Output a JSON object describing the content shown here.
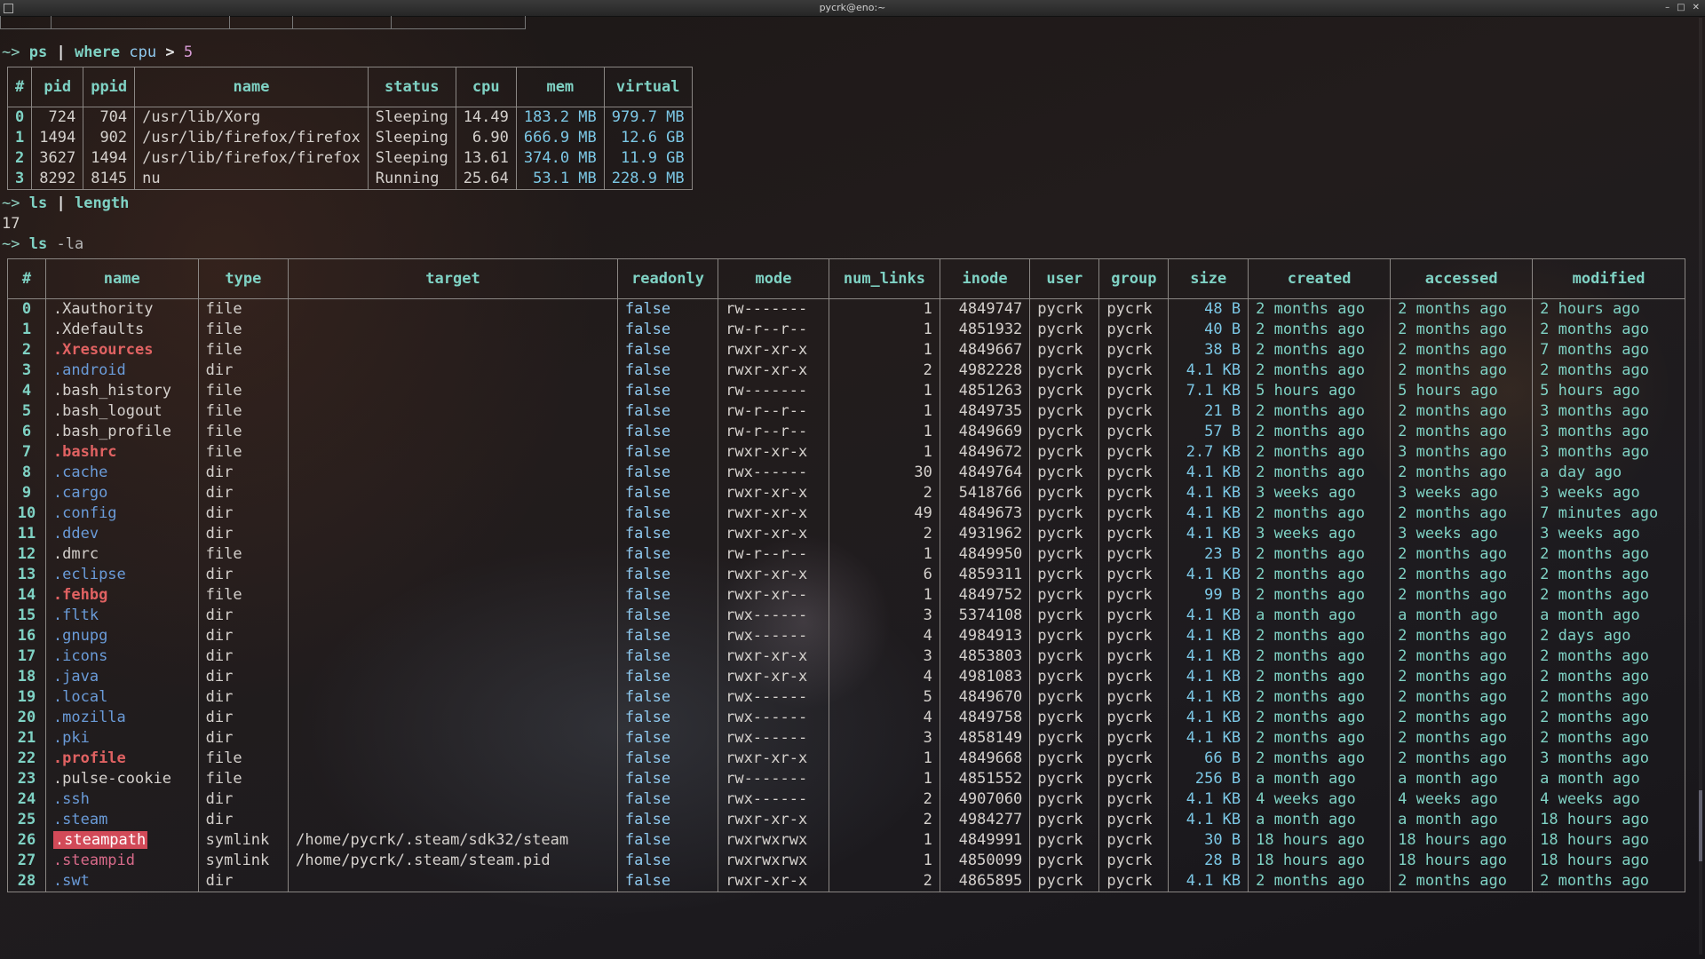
{
  "window": {
    "title": "pycrk@eno:~"
  },
  "prompt": "~>",
  "cmd1": {
    "a": "ps",
    "pipe": "|",
    "kw": "where",
    "col": "cpu",
    "op": ">",
    "val": "5"
  },
  "ps_table": {
    "headers": [
      "#",
      "pid",
      "ppid",
      "name",
      "status",
      "cpu",
      "mem",
      "virtual"
    ],
    "rows": [
      [
        "0",
        "724",
        "704",
        "/usr/lib/Xorg",
        "Sleeping",
        "14.49",
        "183.2 MB",
        "979.7 MB"
      ],
      [
        "1",
        "1494",
        "902",
        "/usr/lib/firefox/firefox",
        "Sleeping",
        "6.90",
        "666.9 MB",
        "12.6 GB"
      ],
      [
        "2",
        "3627",
        "1494",
        "/usr/lib/firefox/firefox",
        "Sleeping",
        "13.61",
        "374.0 MB",
        "11.9 GB"
      ],
      [
        "3",
        "8292",
        "8145",
        "nu",
        "Running",
        "25.64",
        "53.1 MB",
        "228.9 MB"
      ]
    ]
  },
  "cmd2": {
    "a": "ls",
    "pipe": "|",
    "kw": "length"
  },
  "out2": "17",
  "cmd3": {
    "a": "ls",
    "flag": "-la"
  },
  "ls_table": {
    "headers": [
      "#",
      "name",
      "type",
      "target",
      "readonly",
      "mode",
      "num_links",
      "inode",
      "user",
      "group",
      "size",
      "created",
      "accessed",
      "modified"
    ],
    "rows": [
      [
        "0",
        ".Xauthority",
        "file",
        "",
        "false",
        "rw-------",
        "1",
        "4849747",
        "pycrk",
        "pycrk",
        "48 B",
        "2 months ago",
        "2 months ago",
        "2 hours ago",
        "file"
      ],
      [
        "1",
        ".Xdefaults",
        "file",
        "",
        "false",
        "rw-r--r--",
        "1",
        "4851932",
        "pycrk",
        "pycrk",
        "40 B",
        "2 months ago",
        "2 months ago",
        "2 months ago",
        "file"
      ],
      [
        "2",
        ".Xresources",
        "file",
        "",
        "false",
        "rwxr-xr-x",
        "1",
        "4849667",
        "pycrk",
        "pycrk",
        "38 B",
        "2 months ago",
        "2 months ago",
        "7 months ago",
        "exec"
      ],
      [
        "3",
        ".android",
        "dir",
        "",
        "false",
        "rwxr-xr-x",
        "2",
        "4982228",
        "pycrk",
        "pycrk",
        "4.1 KB",
        "2 months ago",
        "2 months ago",
        "2 months ago",
        "dir"
      ],
      [
        "4",
        ".bash_history",
        "file",
        "",
        "false",
        "rw-------",
        "1",
        "4851263",
        "pycrk",
        "pycrk",
        "7.1 KB",
        "5 hours ago",
        "5 hours ago",
        "5 hours ago",
        "file"
      ],
      [
        "5",
        ".bash_logout",
        "file",
        "",
        "false",
        "rw-r--r--",
        "1",
        "4849735",
        "pycrk",
        "pycrk",
        "21 B",
        "2 months ago",
        "2 months ago",
        "3 months ago",
        "file"
      ],
      [
        "6",
        ".bash_profile",
        "file",
        "",
        "false",
        "rw-r--r--",
        "1",
        "4849669",
        "pycrk",
        "pycrk",
        "57 B",
        "2 months ago",
        "2 months ago",
        "3 months ago",
        "file"
      ],
      [
        "7",
        ".bashrc",
        "file",
        "",
        "false",
        "rwxr-xr-x",
        "1",
        "4849672",
        "pycrk",
        "pycrk",
        "2.7 KB",
        "2 months ago",
        "3 months ago",
        "3 months ago",
        "exec"
      ],
      [
        "8",
        ".cache",
        "dir",
        "",
        "false",
        "rwx------",
        "30",
        "4849764",
        "pycrk",
        "pycrk",
        "4.1 KB",
        "2 months ago",
        "2 months ago",
        "a day ago",
        "dir"
      ],
      [
        "9",
        ".cargo",
        "dir",
        "",
        "false",
        "rwxr-xr-x",
        "2",
        "5418766",
        "pycrk",
        "pycrk",
        "4.1 KB",
        "3 weeks ago",
        "3 weeks ago",
        "3 weeks ago",
        "dir"
      ],
      [
        "10",
        ".config",
        "dir",
        "",
        "false",
        "rwxr-xr-x",
        "49",
        "4849673",
        "pycrk",
        "pycrk",
        "4.1 KB",
        "2 months ago",
        "2 months ago",
        "7 minutes ago",
        "dir"
      ],
      [
        "11",
        ".ddev",
        "dir",
        "",
        "false",
        "rwxr-xr-x",
        "2",
        "4931962",
        "pycrk",
        "pycrk",
        "4.1 KB",
        "3 weeks ago",
        "3 weeks ago",
        "3 weeks ago",
        "dir"
      ],
      [
        "12",
        ".dmrc",
        "file",
        "",
        "false",
        "rw-r--r--",
        "1",
        "4849950",
        "pycrk",
        "pycrk",
        "23 B",
        "2 months ago",
        "2 months ago",
        "2 months ago",
        "file"
      ],
      [
        "13",
        ".eclipse",
        "dir",
        "",
        "false",
        "rwxr-xr-x",
        "6",
        "4859311",
        "pycrk",
        "pycrk",
        "4.1 KB",
        "2 months ago",
        "2 months ago",
        "2 months ago",
        "dir"
      ],
      [
        "14",
        ".fehbg",
        "file",
        "",
        "false",
        "rwxr-xr--",
        "1",
        "4849752",
        "pycrk",
        "pycrk",
        "99 B",
        "2 months ago",
        "2 months ago",
        "2 months ago",
        "exec"
      ],
      [
        "15",
        ".fltk",
        "dir",
        "",
        "false",
        "rwx------",
        "3",
        "5374108",
        "pycrk",
        "pycrk",
        "4.1 KB",
        "a month ago",
        "a month ago",
        "a month ago",
        "dir"
      ],
      [
        "16",
        ".gnupg",
        "dir",
        "",
        "false",
        "rwx------",
        "4",
        "4984913",
        "pycrk",
        "pycrk",
        "4.1 KB",
        "2 months ago",
        "2 months ago",
        "2 days ago",
        "dir"
      ],
      [
        "17",
        ".icons",
        "dir",
        "",
        "false",
        "rwxr-xr-x",
        "3",
        "4853803",
        "pycrk",
        "pycrk",
        "4.1 KB",
        "2 months ago",
        "2 months ago",
        "2 months ago",
        "dir"
      ],
      [
        "18",
        ".java",
        "dir",
        "",
        "false",
        "rwxr-xr-x",
        "4",
        "4981083",
        "pycrk",
        "pycrk",
        "4.1 KB",
        "2 months ago",
        "2 months ago",
        "2 months ago",
        "dir"
      ],
      [
        "19",
        ".local",
        "dir",
        "",
        "false",
        "rwx------",
        "5",
        "4849670",
        "pycrk",
        "pycrk",
        "4.1 KB",
        "2 months ago",
        "2 months ago",
        "2 months ago",
        "dir"
      ],
      [
        "20",
        ".mozilla",
        "dir",
        "",
        "false",
        "rwx------",
        "4",
        "4849758",
        "pycrk",
        "pycrk",
        "4.1 KB",
        "2 months ago",
        "2 months ago",
        "2 months ago",
        "dir"
      ],
      [
        "21",
        ".pki",
        "dir",
        "",
        "false",
        "rwx------",
        "3",
        "4858149",
        "pycrk",
        "pycrk",
        "4.1 KB",
        "2 months ago",
        "2 months ago",
        "2 months ago",
        "dir"
      ],
      [
        "22",
        ".profile",
        "file",
        "",
        "false",
        "rwxr-xr-x",
        "1",
        "4849668",
        "pycrk",
        "pycrk",
        "66 B",
        "2 months ago",
        "2 months ago",
        "3 months ago",
        "exec"
      ],
      [
        "23",
        ".pulse-cookie",
        "file",
        "",
        "false",
        "rw-------",
        "1",
        "4851552",
        "pycrk",
        "pycrk",
        "256 B",
        "a month ago",
        "a month ago",
        "a month ago",
        "file"
      ],
      [
        "24",
        ".ssh",
        "dir",
        "",
        "false",
        "rwx------",
        "2",
        "4907060",
        "pycrk",
        "pycrk",
        "4.1 KB",
        "4 weeks ago",
        "4 weeks ago",
        "4 weeks ago",
        "dir"
      ],
      [
        "25",
        ".steam",
        "dir",
        "",
        "false",
        "rwxr-xr-x",
        "2",
        "4984277",
        "pycrk",
        "pycrk",
        "4.1 KB",
        "a month ago",
        "a month ago",
        "18 hours ago",
        "dir"
      ],
      [
        "26",
        ".steampath",
        "symlink",
        "/home/pycrk/.steam/sdk32/steam",
        "false",
        "rwxrwxrwx",
        "1",
        "4849991",
        "pycrk",
        "pycrk",
        "30 B",
        "18 hours ago",
        "18 hours ago",
        "18 hours ago",
        "hl"
      ],
      [
        "27",
        ".steampid",
        "symlink",
        "/home/pycrk/.steam/steam.pid",
        "false",
        "rwxrwxrwx",
        "1",
        "4850099",
        "pycrk",
        "pycrk",
        "28 B",
        "18 hours ago",
        "18 hours ago",
        "18 hours ago",
        "link"
      ],
      [
        "28",
        ".swt",
        "dir",
        "",
        "false",
        "rwxr-xr-x",
        "2",
        "4865895",
        "pycrk",
        "pycrk",
        "4.1 KB",
        "2 months ago",
        "2 months ago",
        "2 months ago",
        "dir"
      ]
    ]
  },
  "colors": {
    "header": "#7fd2c4",
    "dir": "#6a9bd8",
    "exec": "#e06262",
    "symlink": "#d86a8a",
    "highlight_bg": "#d24a58",
    "size": "#7cc8e6"
  }
}
